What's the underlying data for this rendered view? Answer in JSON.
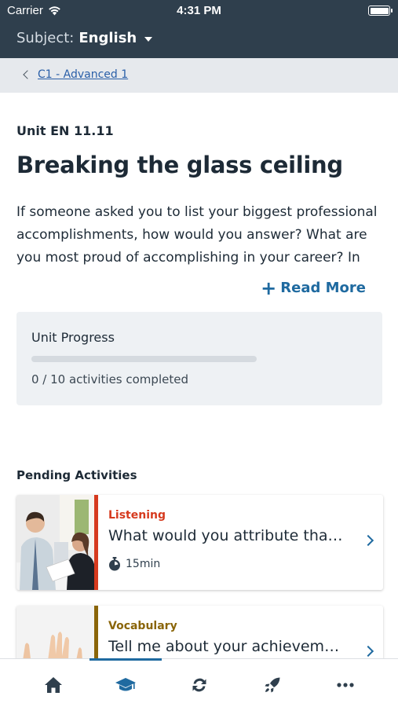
{
  "status_bar": {
    "carrier": "Carrier",
    "time": "4:31 PM"
  },
  "header": {
    "subject_label": "Subject:",
    "subject_value": "English"
  },
  "breadcrumb": {
    "label": "C1 - Advanced 1"
  },
  "unit": {
    "code": "Unit EN 11.11",
    "title": "Breaking the glass ceiling",
    "description": "If someone asked you to list your biggest professional accomplishments, how would you answer? What are you most proud of accomplishing in your career? In this unit",
    "read_more": "Read More"
  },
  "progress": {
    "label": "Unit Progress",
    "text": "0 / 10 activities completed",
    "completed": 0,
    "total": 10
  },
  "pending": {
    "title": "Pending Activities",
    "activities": [
      {
        "category": "Listening",
        "title": "What would you attribute that …",
        "duration": "15min",
        "color": "#d63a1e"
      },
      {
        "category": "Vocabulary",
        "title": "Tell me about your achievements",
        "duration": "",
        "color": "#8a6508"
      }
    ]
  },
  "tabbar": {
    "tabs": [
      "home-icon",
      "graduation-cap-icon",
      "sync-icon",
      "rocket-icon",
      "more-icon"
    ],
    "active": 1,
    "accent": "#1f6aa0",
    "color": "#2f3f4d"
  }
}
